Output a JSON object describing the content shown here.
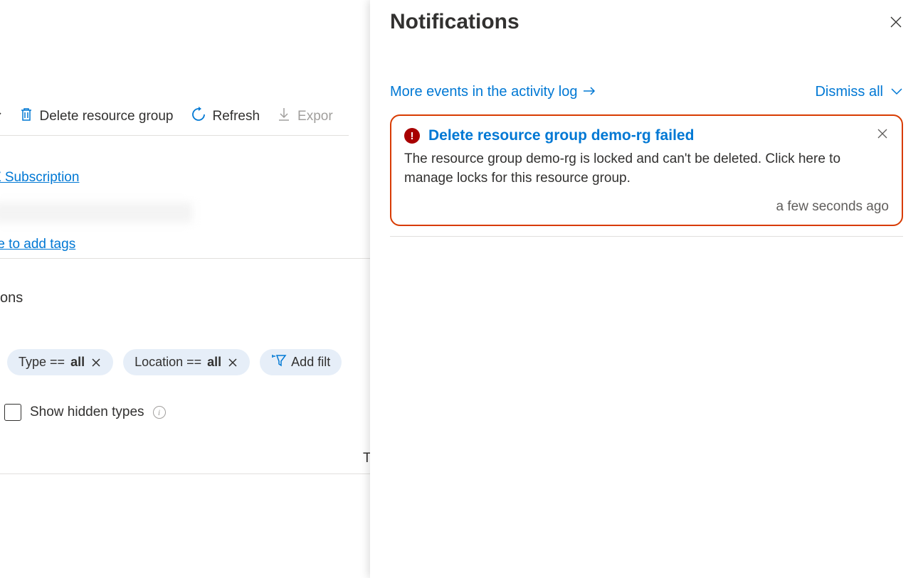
{
  "toolbar": {
    "dropdown_suffix": "v",
    "delete_label": "Delete resource group",
    "refresh_label": "Refresh",
    "export_label": "Expor"
  },
  "main": {
    "subscription_link": "Z Subscription",
    "add_tags_link": "re to add tags",
    "tions_text": "tions",
    "column_header": "T"
  },
  "filters": {
    "type_label": "Type == ",
    "type_value": "all",
    "location_label": "Location == ",
    "location_value": "all",
    "add_filter_label": "Add filt"
  },
  "show_hidden": {
    "label": "Show hidden types"
  },
  "panel": {
    "title": "Notifications",
    "more_events": "More events in the activity log",
    "dismiss_all": "Dismiss all"
  },
  "notification": {
    "title": "Delete resource group demo-rg failed",
    "body": "The resource group demo-rg is locked and can't be deleted. Click here to manage locks for this resource group.",
    "timestamp": "a few seconds ago"
  }
}
